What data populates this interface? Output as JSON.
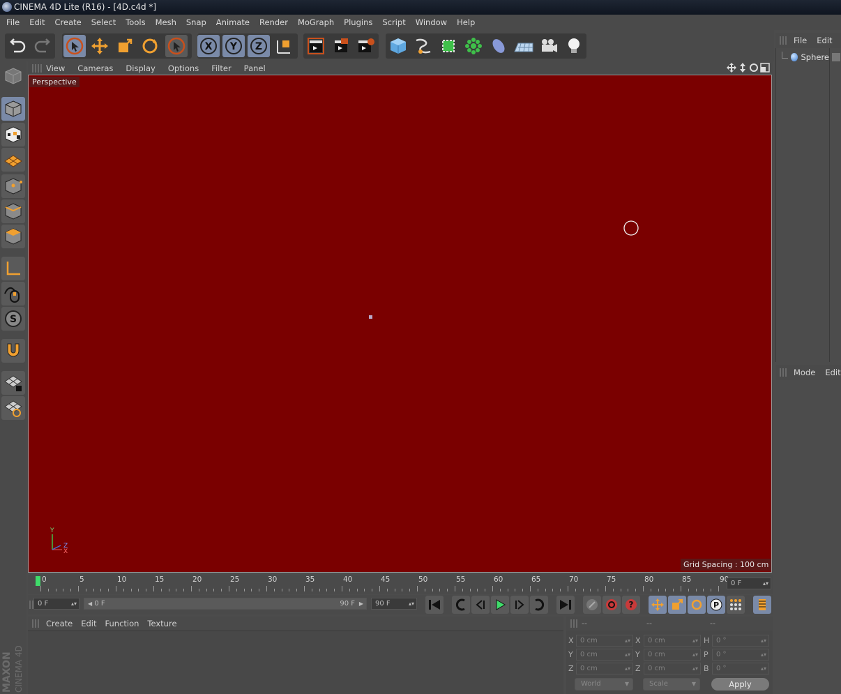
{
  "window": {
    "title": "CINEMA 4D Lite (R16) - [4D.c4d *]"
  },
  "menubar": [
    "File",
    "Edit",
    "Create",
    "Select",
    "Tools",
    "Mesh",
    "Snap",
    "Animate",
    "Render",
    "MoGraph",
    "Plugins",
    "Script",
    "Window",
    "Help"
  ],
  "viewport": {
    "menu": [
      "View",
      "Cameras",
      "Display",
      "Options",
      "Filter",
      "Panel"
    ],
    "label": "Perspective",
    "grid_spacing": "Grid Spacing : 100 cm",
    "background": "#7a0000",
    "axis": {
      "y": "Y",
      "z": "Z",
      "x": "X"
    }
  },
  "timeline": {
    "ticks": [
      "0",
      "5",
      "10",
      "15",
      "20",
      "25",
      "30",
      "35",
      "40",
      "45",
      "50",
      "55",
      "60",
      "65",
      "70",
      "75",
      "80",
      "85",
      "90"
    ],
    "current": "0 F"
  },
  "transport": {
    "start": "0 F",
    "range_start": "0 F",
    "range_end": "90 F",
    "end": "90 F"
  },
  "material_manager": {
    "menu": [
      "Create",
      "Edit",
      "Function",
      "Texture"
    ]
  },
  "coordinates": {
    "headers": [
      "--",
      "--",
      "--"
    ],
    "rows": [
      {
        "l1": "X",
        "v1": "0 cm",
        "l2": "X",
        "v2": "0 cm",
        "l3": "H",
        "v3": "0 °"
      },
      {
        "l1": "Y",
        "v1": "0 cm",
        "l2": "Y",
        "v2": "0 cm",
        "l3": "P",
        "v3": "0 °"
      },
      {
        "l1": "Z",
        "v1": "0 cm",
        "l2": "Z",
        "v2": "0 cm",
        "l3": "B",
        "v3": "0 °"
      }
    ],
    "mode1": "World",
    "mode2": "Scale",
    "apply": "Apply"
  },
  "object_manager": {
    "menu": [
      "File",
      "Edit"
    ],
    "objects": [
      "Sphere"
    ]
  },
  "attribute_manager": {
    "menu": [
      "Mode",
      "Edit"
    ]
  },
  "brand": {
    "line1": "MAXON",
    "line2": "CINEMA 4D"
  },
  "colors": {
    "accent": "#f0a030",
    "active": "#7a8aa8"
  }
}
